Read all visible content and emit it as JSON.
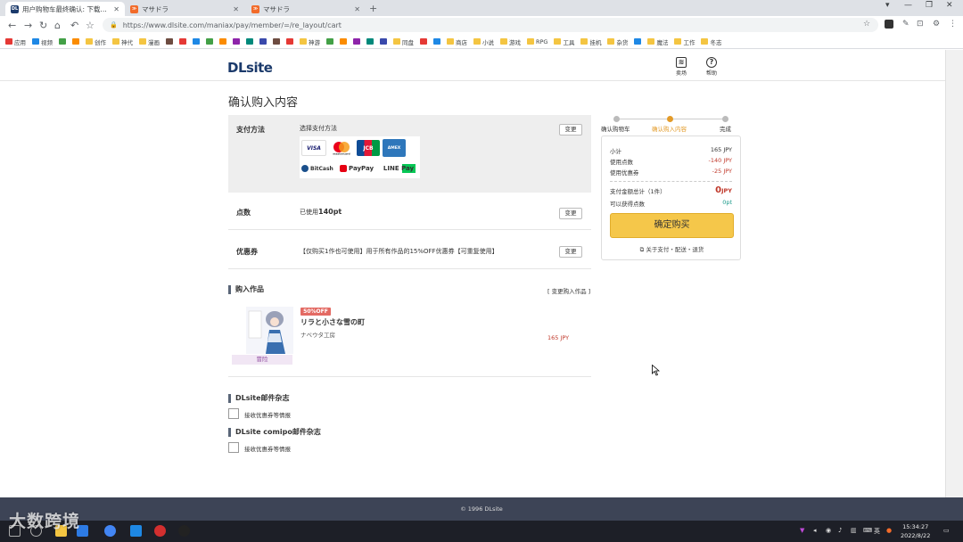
{
  "browser": {
    "tabs": [
      {
        "title": "用户购物车最终确认: 下载同人志",
        "favicon": "DL",
        "color": "#1b3a6b"
      },
      {
        "title": "マサドラ",
        "favicon": "≫",
        "color": "#f26b2a"
      },
      {
        "title": "マサドラ",
        "favicon": "≫",
        "color": "#f26b2a"
      }
    ],
    "url": "https://www.dlsite.com/maniax/pay/member/=/re_layout/cart",
    "bookmarks": [
      "应用",
      "视频",
      "",
      "",
      "创作",
      "神代",
      "漫画",
      "",
      "",
      "",
      "",
      "",
      "",
      "",
      "",
      "",
      "",
      "神游",
      "",
      "",
      "",
      "",
      "",
      "同盘",
      "",
      "",
      "商店",
      "小说",
      "游戏",
      "RPG",
      "工具",
      "挂机",
      "杂货",
      "",
      "魔法",
      "工作",
      "冬志"
    ]
  },
  "header": {
    "logo": "DLsite",
    "icons": [
      {
        "name": "layers-icon",
        "label": "卖场"
      },
      {
        "name": "help-icon",
        "label": "帮助",
        "glyph": "?"
      }
    ]
  },
  "page": {
    "title": "确认购入内容",
    "payment": {
      "label": "支付方法",
      "value": "选择支付方法",
      "change": "变更",
      "cards": [
        "VISA",
        "mastercard",
        "JCB",
        "AMEX",
        "BitCash",
        "PayPay",
        "LINE Pay"
      ]
    },
    "points": {
      "label": "点数",
      "prefix": "已使用",
      "value": "140pt",
      "change": "变更"
    },
    "coupon": {
      "label": "优惠券",
      "value": "【仅购买1作也可使用】用于所有作品的15%OFF优惠券【可重复使用】",
      "change": "变更"
    },
    "purchase": {
      "title": "购入作品",
      "change_link": "[ 变更购入作品 ]",
      "item": {
        "badge": "50%OFF",
        "title": "リラと小さな雪の町",
        "circle": "ナベウタ工房",
        "price": "165 JPY",
        "genre": "冒险"
      }
    },
    "newsletters": [
      {
        "title": "DLsite邮件杂志",
        "checkbox_label": "接收优惠券等情报"
      },
      {
        "title": "DLsite comipo邮件杂志",
        "checkbox_label": "接收优惠券等情报"
      }
    ]
  },
  "sidebar": {
    "steps": [
      "确认购物车",
      "确认购入内容",
      "完成"
    ],
    "active_step": 1,
    "subtotal": {
      "label": "小计",
      "value": "165 JPY"
    },
    "points_used": {
      "label": "使用点数",
      "value": "-140 JPY"
    },
    "coupon_used": {
      "label": "使用优惠券",
      "value": "-25 JPY"
    },
    "total": {
      "label": "支付金额总计（1件）",
      "value": "0",
      "unit": "JPY"
    },
    "earn": {
      "label": "可以获得点数",
      "value": "0pt"
    },
    "buy_button": "确定购买",
    "about_link": "关于支付・配送・退货"
  },
  "footer": {
    "copyright": "© 1996 DLsite"
  },
  "taskbar": {
    "watermark": "大数跨境",
    "clock_time": "15:34:27",
    "clock_date": "2022/8/22",
    "lang": "英"
  }
}
